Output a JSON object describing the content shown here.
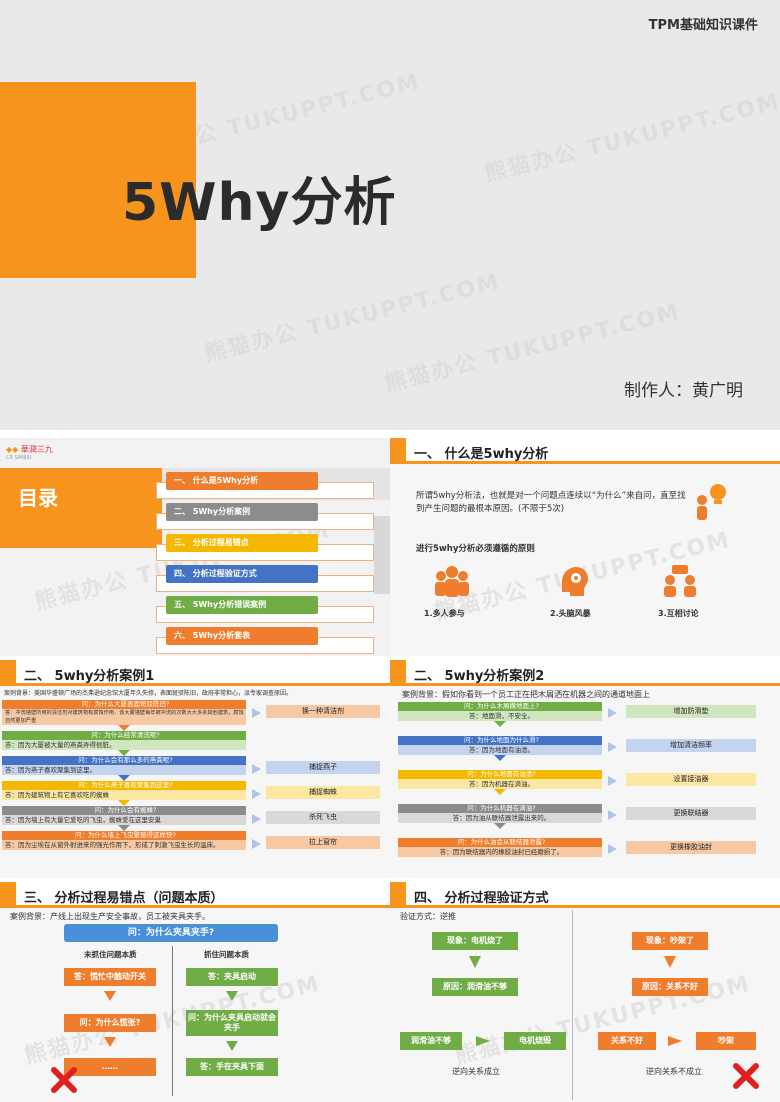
{
  "cover": {
    "top_label": "TPM基础知识课件",
    "title": "5Why分析",
    "author": "制作人：黄广明",
    "watermark": "熊猫办公 TUKUPPT.COM"
  },
  "toc": {
    "logo_text": "華潤三九",
    "logo_sub": "CR SANJIU",
    "heading": "目录",
    "items": [
      {
        "label": "一、 什么是5Why分析",
        "color": "#ef7d2e"
      },
      {
        "label": "二、 5Why分析案例",
        "color": "#8c8c8c"
      },
      {
        "label": "三、 分析过程易错点",
        "color": "#f5b800"
      },
      {
        "label": "四、 分析过程验证方式",
        "color": "#4472c4"
      },
      {
        "label": "五、 5Why分析错误案例",
        "color": "#70ad47"
      },
      {
        "label": "六、 5Why分析套表",
        "color": "#ef7d2e"
      }
    ]
  },
  "slide_what": {
    "title": "一、 什么是5why分析",
    "definition": "所谓5why分析法，也就是对一个问题点连续以“为什么”来自问，直至找到产生问题的最根本原因。(不限于5次)",
    "principle_title": "进行5why分析必须遵循的原则",
    "principles": [
      "1.多人参与",
      "2.头脑风暴",
      "3.互相讨论"
    ]
  },
  "case1": {
    "title": "二、 5why分析案例1",
    "background": "案例背景：美国华盛顿广场的杰弗逊纪念馆大厦年久失修，表面斑驳陈旧，政府非常担心，派专家调查原因。",
    "rows": [
      {
        "q": "问：为什么大厦表面斑驳陈旧?",
        "a": "答：冲洗墙壁所用的清洁剂对建筑物有腐蚀作用，该大厦墙壁每年被冲洗的次数大大多余其他建筑，腐蚀自然更加严重",
        "action": "换一种清洁剂",
        "qc": "#ef7d2e",
        "ac": "#f6c9a4",
        "tc": "#f6c9a4"
      },
      {
        "q": "问：为什么经常清洗呢?",
        "a": "答：因为大厦被大量的燕粪弄得很脏。",
        "action": "",
        "qc": "#70ad47",
        "ac": "#cfe6bf",
        "tc": ""
      },
      {
        "q": "问：为什么会有那么多的燕粪呢?",
        "a": "答：因为燕子喜欢聚集到这里。",
        "action": "捕捉燕子",
        "qc": "#4472c4",
        "ac": "#c4d3ee",
        "tc": "#c4d3ee"
      },
      {
        "q": "问：为什么燕子喜欢聚集到这里?",
        "a": "答：因为建筑物上有它喜欢吃的蜘蛛",
        "action": "捕捉蜘蛛",
        "qc": "#f5b800",
        "ac": "#fbe6a2",
        "tc": "#fbe6a2"
      },
      {
        "q": "问：为什么会有蜘蛛?",
        "a": "答：因为墙上有大量它爱吃的飞虫，蜘蛛爱在这里安巢",
        "action": "杀死飞虫",
        "qc": "#8c8c8c",
        "ac": "#d9d9d9",
        "tc": "#d9d9d9"
      },
      {
        "q": "问：为什么墙上飞虫繁殖得这样快?",
        "a": "答：因为尘埃在从窗外射进来的强光作用下，形成了刺激飞虫生长的温床。",
        "action": "拉上窗帘",
        "qc": "#ef7d2e",
        "ac": "#f6c9a4",
        "tc": "#f6c9a4"
      }
    ]
  },
  "case2": {
    "title": "二、 5why分析案例2",
    "background": "案例背景：假如你看到一个员工正在把木屑洒在机器之间的通道地面上",
    "rows": [
      {
        "q": "问：为什么木屑撒地面上?",
        "a": "答：地面滑，不安全。",
        "action": "增加防滑垫",
        "qc": "#70ad47",
        "ac": "#cfe6bf"
      },
      {
        "q": "问：为什么地面为什么滑?",
        "a": "答：因为地面有油渍。",
        "action": "增加清洁频率",
        "qc": "#4472c4",
        "ac": "#c4d3ee"
      },
      {
        "q": "问：为什么地面有油渍?",
        "a": "答：因为机器在滴油。",
        "action": "设置接油器",
        "qc": "#f5b800",
        "ac": "#fbe6a2"
      },
      {
        "q": "问：为什么机器在滴油?",
        "a": "答：因为油从联结器泄露出来的。",
        "action": "更换联结器",
        "qc": "#8c8c8c",
        "ac": "#d9d9d9"
      },
      {
        "q": "问：为什么油会从联结器泄露?",
        "a": "答：因为联结器内的橡胶油封已经磨损了。",
        "action": "更换橡胶油封",
        "qc": "#ef7d2e",
        "ac": "#f6c9a4"
      }
    ]
  },
  "errors": {
    "title": "三、 分析过程易错点（问题本质）",
    "background": "案例背景：产线上出现生产安全事故，员工被夹具夹手。",
    "question": "问：为什么夹具夹手?",
    "left_head": "未抓住问题本质",
    "right_head": "抓住问题本质",
    "left": [
      "答：慌忙中触动开关",
      "问：为什么慌张?",
      "……"
    ],
    "right": [
      "答：夹具启动",
      "问：为什么夹具启动就会夹手",
      "答：手在夹具下面"
    ]
  },
  "verify": {
    "title": "四、 分析过程验证方式",
    "method": "验证方式：逆推",
    "left": {
      "phenomenon": "现象：电机烧了",
      "cause": "原因：润滑油不够",
      "from": "润滑油不够",
      "to": "电机烧毁",
      "caption": "逆向关系成立"
    },
    "right": {
      "phenomenon": "现象：吵架了",
      "cause": "原因：关系不好",
      "from": "关系不好",
      "to": "吵架",
      "caption": "逆向关系不成立"
    }
  },
  "colors": {
    "orange": "#f7941d",
    "green": "#70ad47",
    "blue": "#4472c4",
    "red": "#e02020",
    "gray": "#8c8c8c"
  }
}
